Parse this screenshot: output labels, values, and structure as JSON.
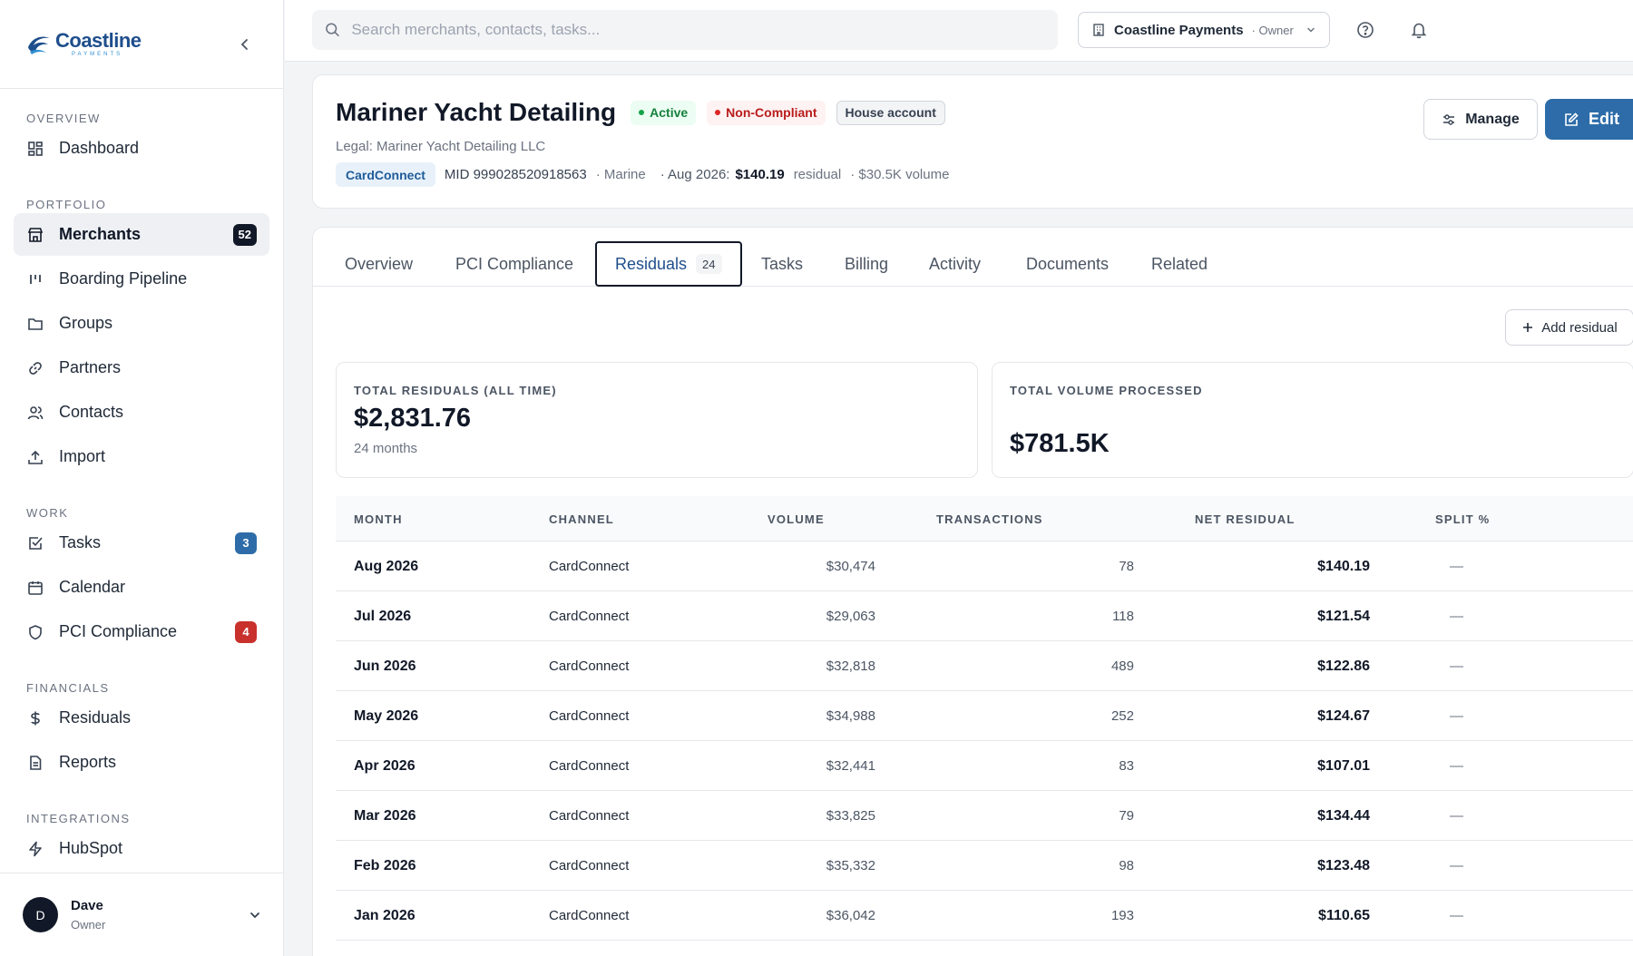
{
  "brand": {
    "name": "Coastline",
    "sub": "PAYMENTS"
  },
  "sidebar": {
    "sections": [
      {
        "label": "OVERVIEW",
        "items": [
          {
            "label": "Dashboard",
            "icon": "dashboard-icon"
          }
        ]
      },
      {
        "label": "PORTFOLIO",
        "items": [
          {
            "label": "Merchants",
            "icon": "store-icon",
            "badge": "52",
            "active": true
          },
          {
            "label": "Boarding Pipeline",
            "icon": "pipeline-icon"
          },
          {
            "label": "Groups",
            "icon": "folder-icon"
          },
          {
            "label": "Partners",
            "icon": "link-icon"
          },
          {
            "label": "Contacts",
            "icon": "users-icon"
          },
          {
            "label": "Import",
            "icon": "upload-icon"
          }
        ]
      },
      {
        "label": "WORK",
        "items": [
          {
            "label": "Tasks",
            "icon": "checkbox-icon",
            "badge": "3"
          },
          {
            "label": "Calendar",
            "icon": "calendar-icon"
          },
          {
            "label": "PCI Compliance",
            "icon": "shield-icon",
            "badge": "4"
          }
        ]
      },
      {
        "label": "FINANCIALS",
        "items": [
          {
            "label": "Residuals",
            "icon": "dollar-icon"
          },
          {
            "label": "Reports",
            "icon": "document-icon"
          }
        ]
      },
      {
        "label": "INTEGRATIONS",
        "items": [
          {
            "label": "HubSpot",
            "icon": "bolt-icon"
          }
        ]
      }
    ],
    "user": {
      "initial": "D",
      "name": "Dave",
      "role": "Owner"
    }
  },
  "topbar": {
    "search_placeholder": "Search merchants, contacts, tasks...",
    "org_name": "Coastline Payments",
    "org_role": "· Owner"
  },
  "merchant": {
    "name": "Mariner Yacht Detailing",
    "status": "Active",
    "compliance": "Non-Compliant",
    "house": "House account",
    "legal": "Legal: Mariner Yacht Detailing LLC",
    "processor": "CardConnect",
    "mid": "MID 999028520918563",
    "industry": "· Marine",
    "period_label": "· Aug 2026:",
    "period_residual": "$140.19",
    "residual_word": "residual",
    "volume_text": "· $30.5K volume"
  },
  "actions": {
    "manage": "Manage",
    "edit": "Edit",
    "add_residual": "Add residual"
  },
  "tabs": [
    {
      "label": "Overview"
    },
    {
      "label": "PCI Compliance"
    },
    {
      "label": "Residuals",
      "count": "24",
      "selected": true
    },
    {
      "label": "Tasks"
    },
    {
      "label": "Billing"
    },
    {
      "label": "Activity"
    },
    {
      "label": "Documents"
    },
    {
      "label": "Related"
    }
  ],
  "stats": {
    "total_residuals": {
      "label": "TOTAL RESIDUALS (ALL TIME)",
      "value": "$2,831.76",
      "sub": "24 months"
    },
    "total_volume": {
      "label": "TOTAL VOLUME PROCESSED",
      "value": "$781.5K"
    }
  },
  "table": {
    "columns": [
      "MONTH",
      "CHANNEL",
      "VOLUME",
      "TRANSACTIONS",
      "NET RESIDUAL",
      "SPLIT %"
    ],
    "rows": [
      {
        "month": "Aug 2026",
        "channel": "CardConnect",
        "volume": "$30,474",
        "transactions": "78",
        "net_residual": "$140.19",
        "split": "—"
      },
      {
        "month": "Jul 2026",
        "channel": "CardConnect",
        "volume": "$29,063",
        "transactions": "118",
        "net_residual": "$121.54",
        "split": "—"
      },
      {
        "month": "Jun 2026",
        "channel": "CardConnect",
        "volume": "$32,818",
        "transactions": "489",
        "net_residual": "$122.86",
        "split": "—"
      },
      {
        "month": "May 2026",
        "channel": "CardConnect",
        "volume": "$34,988",
        "transactions": "252",
        "net_residual": "$124.67",
        "split": "—"
      },
      {
        "month": "Apr 2026",
        "channel": "CardConnect",
        "volume": "$32,441",
        "transactions": "83",
        "net_residual": "$107.01",
        "split": "—"
      },
      {
        "month": "Mar 2026",
        "channel": "CardConnect",
        "volume": "$33,825",
        "transactions": "79",
        "net_residual": "$134.44",
        "split": "—"
      },
      {
        "month": "Feb 2026",
        "channel": "CardConnect",
        "volume": "$35,332",
        "transactions": "98",
        "net_residual": "$123.48",
        "split": "—"
      },
      {
        "month": "Jan 2026",
        "channel": "CardConnect",
        "volume": "$36,042",
        "transactions": "193",
        "net_residual": "$110.65",
        "split": "—"
      }
    ]
  },
  "colors": {
    "accent": "#2d6ca8",
    "brand": "#1e4e8c",
    "danger": "#c8312c",
    "success": "#15803d"
  }
}
